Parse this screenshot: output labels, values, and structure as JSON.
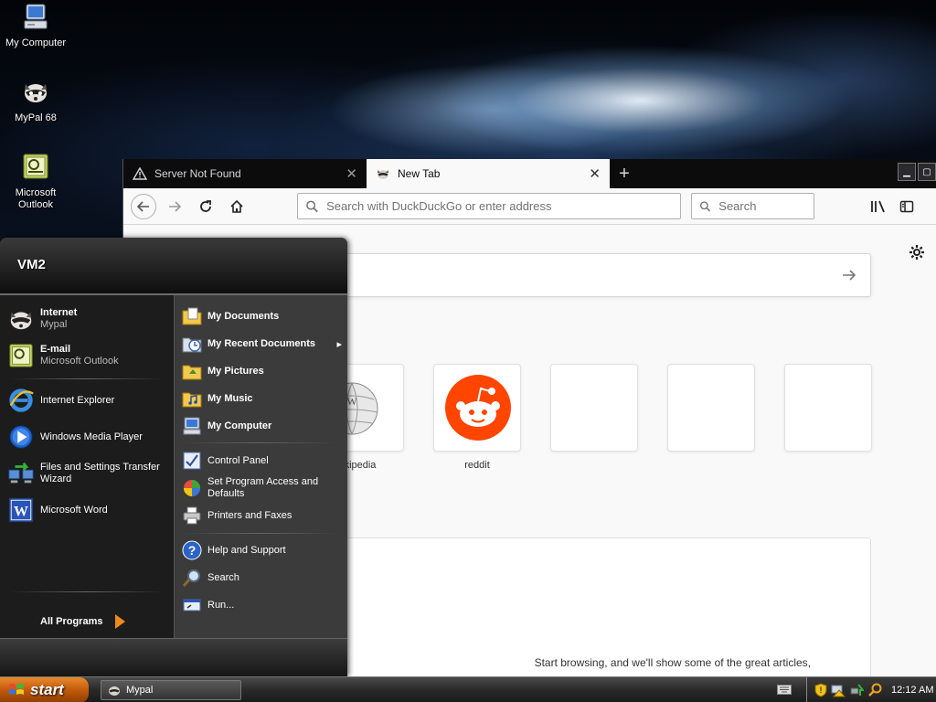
{
  "desktop": {
    "icons": [
      {
        "label": "My Computer"
      },
      {
        "label": "MyPal 68"
      },
      {
        "label_line1": "Microsoft",
        "label_line2": "Outlook"
      }
    ]
  },
  "browser": {
    "tabs": [
      {
        "title": "Server Not Found",
        "close": "✕"
      },
      {
        "title": "New Tab",
        "close": "✕"
      }
    ],
    "new_tab": "+",
    "window_controls": {
      "minimize": "▁",
      "maximize": "▢"
    },
    "url_placeholder": "Search with DuckDuckGo or enter address",
    "search_placeholder": "Search",
    "top_sites": [
      {
        "label": "kipedia"
      },
      {
        "label": "reddit"
      }
    ],
    "highlights_text": "Start browsing, and we'll show some of the great articles,"
  },
  "start_menu": {
    "user": "VM2",
    "pinned": [
      {
        "title": "Internet",
        "subtitle": "Mypal"
      },
      {
        "title": "E-mail",
        "subtitle": "Microsoft Outlook"
      }
    ],
    "recent": [
      {
        "label": "Internet Explorer"
      },
      {
        "label": "Windows Media Player"
      },
      {
        "line1": "Files and Settings Transfer",
        "line2": "Wizard"
      },
      {
        "label": "Microsoft Word"
      }
    ],
    "all_programs": "All Programs",
    "places": [
      {
        "label": "My Documents"
      },
      {
        "label": "My Recent Documents",
        "arrow": "▸"
      },
      {
        "label": "My Pictures"
      },
      {
        "label": "My Music"
      },
      {
        "label": "My Computer"
      }
    ],
    "system": [
      {
        "label": "Control Panel"
      },
      {
        "line1": "Set Program Access and",
        "line2": "Defaults"
      },
      {
        "label": "Printers and Faxes"
      }
    ],
    "help": [
      {
        "label": "Help and Support"
      },
      {
        "label": "Search"
      },
      {
        "label": "Run..."
      }
    ]
  },
  "taskbar": {
    "start_label": "start",
    "tasks": [
      {
        "label": "Mypal"
      }
    ],
    "clock": "12:12 AM"
  }
}
